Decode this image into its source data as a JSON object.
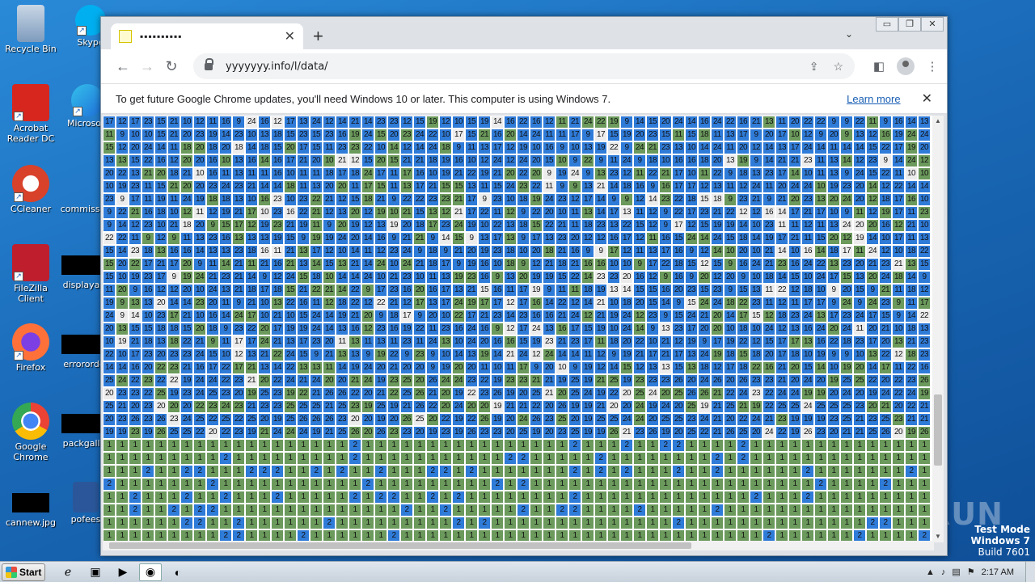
{
  "desktop": {
    "icons": [
      {
        "label": "Recycle Bin",
        "color": "#5c7fa6"
      },
      {
        "label": "Skype",
        "color": "#00aff0"
      },
      {
        "label": "Acrobat Reader DC",
        "color": "#d7261e"
      },
      {
        "label": "Microsoft",
        "color": "#1e88e5"
      },
      {
        "label": "CCleaner",
        "color": "#d8412a"
      },
      {
        "label": "commissio",
        "color": ""
      },
      {
        "label": "FileZilla Client",
        "color": "#bf1e2d"
      },
      {
        "label": "displayau",
        "color": ""
      },
      {
        "label": "Firefox",
        "color": "#ff7139"
      },
      {
        "label": "errororde",
        "color": ""
      },
      {
        "label": "Google Chrome",
        "color": "#34a853"
      },
      {
        "label": "packgalle",
        "color": ""
      },
      {
        "label": "cannew.jpg",
        "color": ""
      },
      {
        "label": "pofees",
        "color": "#2b579a"
      }
    ]
  },
  "browser": {
    "tab_title": "▪▪▪▪▪▪▪▪▪▪",
    "url": "yyyyyyy.info/l/data/",
    "infobar": {
      "message": "To get future Google Chrome updates, you'll need Windows 10 or later. This computer is using Windows 7.",
      "link": "Learn more"
    }
  },
  "grid": {
    "colors": {
      "blue": "#2f7bd8",
      "green": "#6b9a5c",
      "white": "#ececec"
    },
    "columns": 64,
    "upper_rows": 25,
    "lower_rows": 8
  },
  "overlay": {
    "watermark": "ANY RUN",
    "test_mode": "Test Mode",
    "os": "Windows 7",
    "build": "Build 7601"
  },
  "taskbar": {
    "start_label": "Start",
    "clock": "2:17 AM"
  }
}
